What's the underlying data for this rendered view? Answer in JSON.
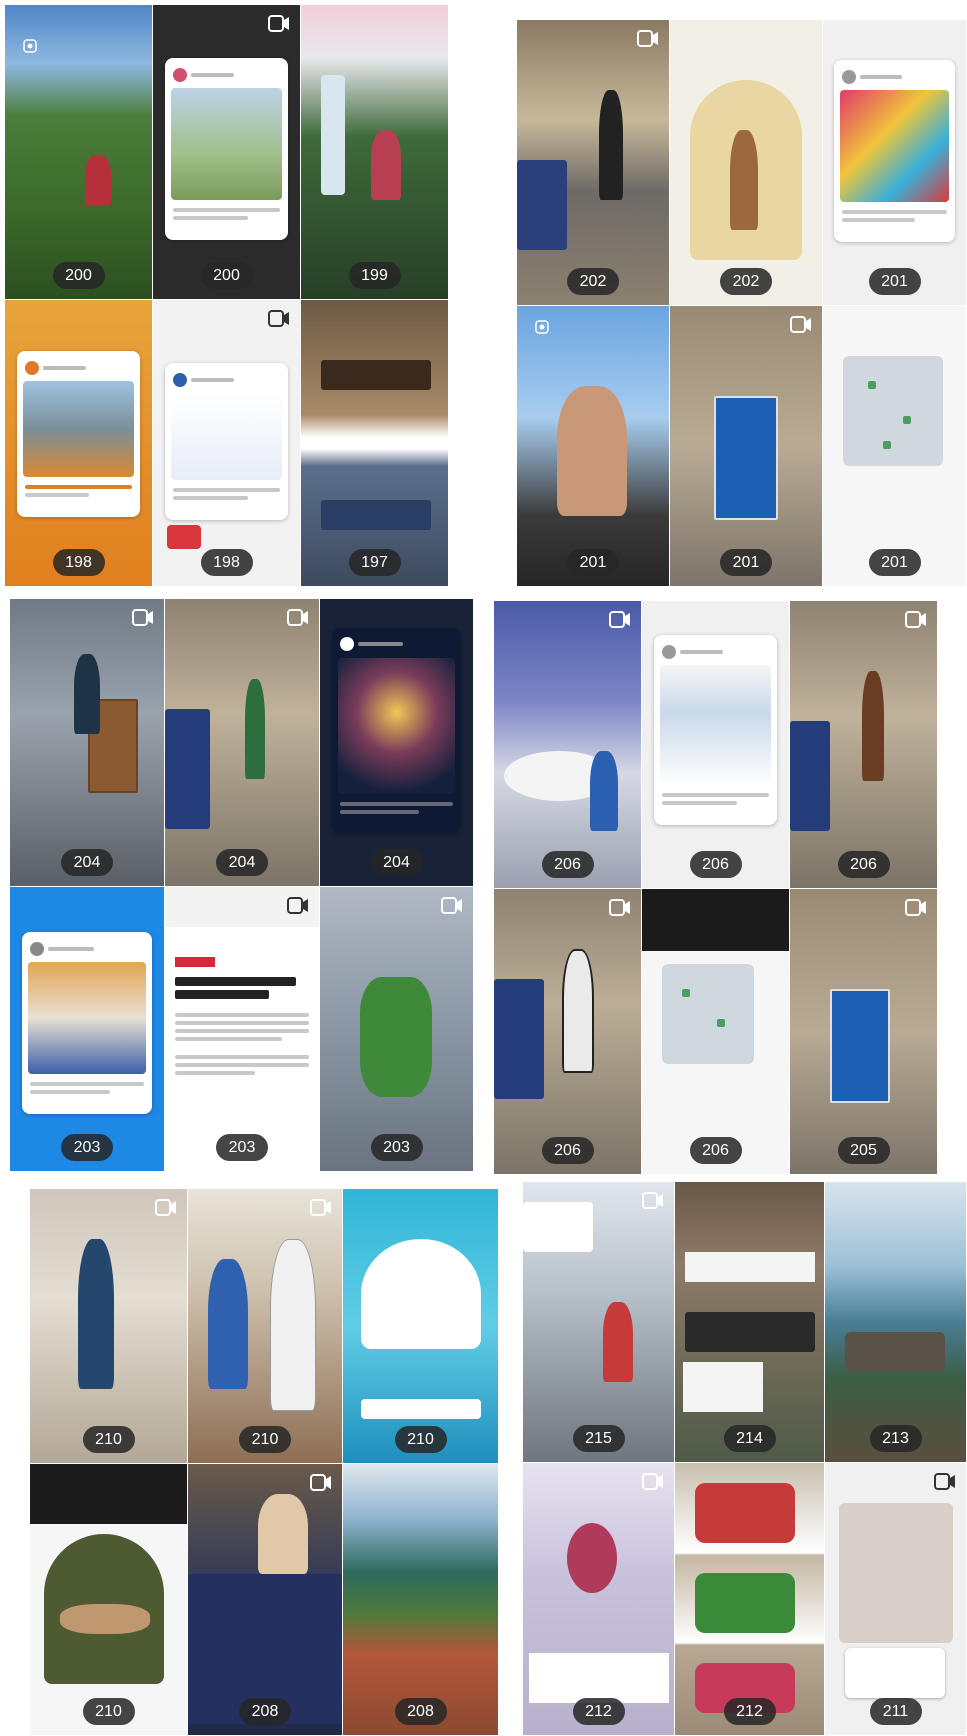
{
  "colors": {
    "badge_bg": "#262626",
    "badge_text": "#ffffff",
    "reel_icon": "#ffffff",
    "page_bg": "#ffffff"
  },
  "icons": {
    "reel": "reel-icon",
    "story": "story-icon"
  },
  "panels": [
    {
      "id": "panel-1",
      "tiles": [
        {
          "count": "200",
          "icon": "story"
        },
        {
          "count": "200",
          "icon": "reel"
        },
        {
          "count": "199",
          "icon": "none"
        },
        {
          "count": "198",
          "icon": "none"
        },
        {
          "count": "198",
          "icon": "reel"
        },
        {
          "count": "197",
          "icon": "none"
        }
      ]
    },
    {
      "id": "panel-2",
      "tiles": [
        {
          "count": "202",
          "icon": "reel"
        },
        {
          "count": "202",
          "icon": "none"
        },
        {
          "count": "201",
          "icon": "none"
        },
        {
          "count": "201",
          "icon": "story"
        },
        {
          "count": "201",
          "icon": "reel"
        },
        {
          "count": "201",
          "icon": "none"
        }
      ]
    },
    {
      "id": "panel-3",
      "tiles": [
        {
          "count": "204",
          "icon": "reel"
        },
        {
          "count": "204",
          "icon": "reel"
        },
        {
          "count": "204",
          "icon": "none"
        },
        {
          "count": "203",
          "icon": "none"
        },
        {
          "count": "203",
          "icon": "reel"
        },
        {
          "count": "203",
          "icon": "reel"
        }
      ]
    },
    {
      "id": "panel-4",
      "tiles": [
        {
          "count": "206",
          "icon": "reel"
        },
        {
          "count": "206",
          "icon": "none"
        },
        {
          "count": "206",
          "icon": "reel"
        },
        {
          "count": "206",
          "icon": "reel"
        },
        {
          "count": "206",
          "icon": "none"
        },
        {
          "count": "205",
          "icon": "reel"
        }
      ]
    },
    {
      "id": "panel-5",
      "tiles": [
        {
          "count": "210",
          "icon": "reel"
        },
        {
          "count": "210",
          "icon": "reel"
        },
        {
          "count": "210",
          "icon": "none"
        },
        {
          "count": "210",
          "icon": "none"
        },
        {
          "count": "208",
          "icon": "reel"
        },
        {
          "count": "208",
          "icon": "none"
        }
      ]
    },
    {
      "id": "panel-6",
      "tiles": [
        {
          "count": "215",
          "icon": "reel"
        },
        {
          "count": "214",
          "icon": "none"
        },
        {
          "count": "213",
          "icon": "none"
        },
        {
          "count": "212",
          "icon": "reel"
        },
        {
          "count": "212",
          "icon": "none"
        },
        {
          "count": "211",
          "icon": "reel"
        }
      ]
    }
  ]
}
